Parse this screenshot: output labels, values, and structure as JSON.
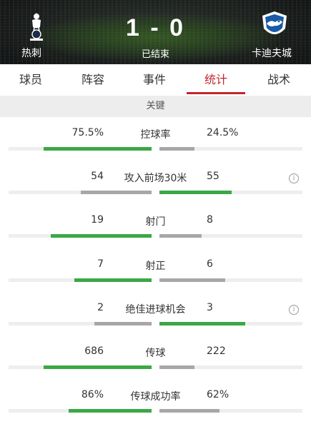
{
  "match": {
    "home_team": "热刺",
    "away_team": "卡迪夫城",
    "score": "1 - 0",
    "status": "已结束"
  },
  "tabs": [
    {
      "label": "球员",
      "active": false
    },
    {
      "label": "阵容",
      "active": false
    },
    {
      "label": "事件",
      "active": false
    },
    {
      "label": "统计",
      "active": true
    },
    {
      "label": "战术",
      "active": false
    }
  ],
  "section": {
    "title": "关键"
  },
  "colors": {
    "accent": "#c2252c",
    "home_bar": "#3aa846",
    "away_bar": "#a7a7a7",
    "leader_bar": "#3aa846"
  },
  "stats": [
    {
      "label": "控球率",
      "home": "75.5%",
      "away": "24.5%",
      "home_share": 0.755,
      "away_share": 0.245,
      "leader": "home",
      "info": false
    },
    {
      "label": "攻入前场30米",
      "home": "54",
      "away": "55",
      "home_share": 0.495,
      "away_share": 0.505,
      "leader": "away",
      "info": true
    },
    {
      "label": "射门",
      "home": "19",
      "away": "8",
      "home_share": 0.704,
      "away_share": 0.296,
      "leader": "home",
      "info": false
    },
    {
      "label": "射正",
      "home": "7",
      "away": "6",
      "home_share": 0.538,
      "away_share": 0.462,
      "leader": "home",
      "info": false
    },
    {
      "label": "绝佳进球机会",
      "home": "2",
      "away": "3",
      "home_share": 0.4,
      "away_share": 0.6,
      "leader": "away",
      "info": true
    },
    {
      "label": "传球",
      "home": "686",
      "away": "222",
      "home_share": 0.756,
      "away_share": 0.244,
      "leader": "home",
      "info": false
    },
    {
      "label": "传球成功率",
      "home": "86%",
      "away": "62%",
      "home_share": 0.581,
      "away_share": 0.419,
      "leader": "home",
      "info": false
    }
  ]
}
